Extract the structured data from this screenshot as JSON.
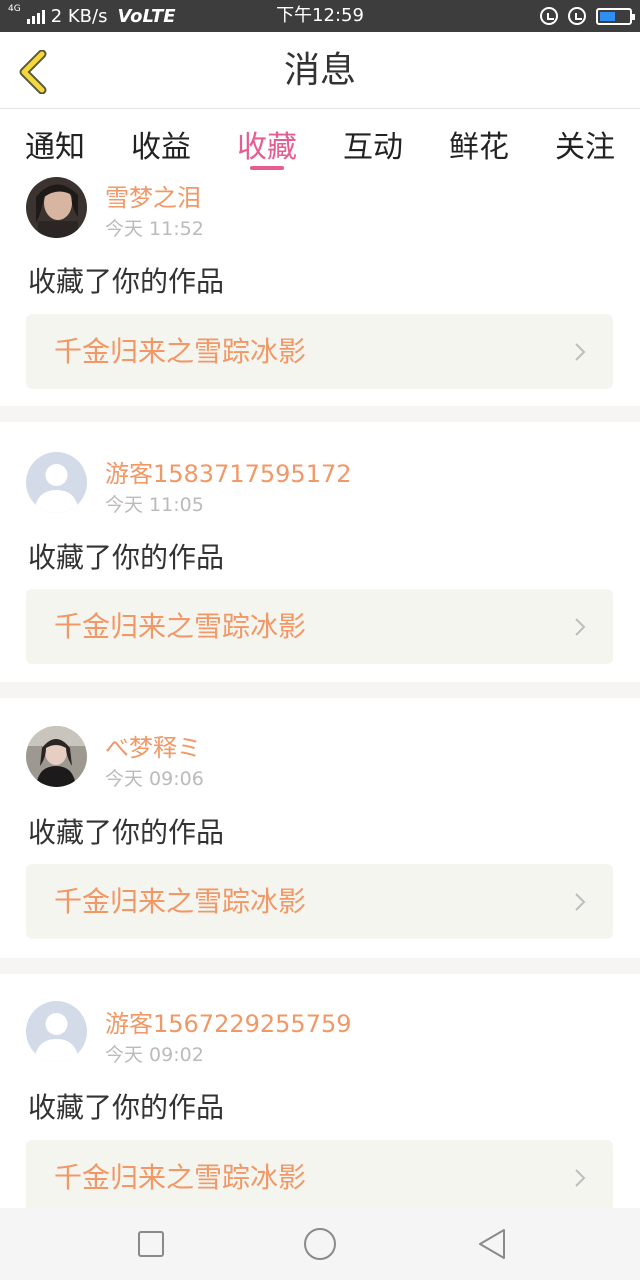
{
  "status_bar": {
    "network_type": "4G",
    "speed": "2 KB/s",
    "volte": "VoLTE",
    "time": "下午12:59",
    "battery_level": 0.55,
    "icons": [
      "signal-icon",
      "lock-rotation-icon",
      "alarm-icon",
      "battery-icon"
    ]
  },
  "header": {
    "title": "消息",
    "back_icon": "chevron-left-icon",
    "accent_color": "#f5d93a"
  },
  "tabs": [
    {
      "label": "通知",
      "active": false
    },
    {
      "label": "收益",
      "active": false
    },
    {
      "label": "收藏",
      "active": true
    },
    {
      "label": "互动",
      "active": false
    },
    {
      "label": "鲜花",
      "active": false
    },
    {
      "label": "关注",
      "active": false
    }
  ],
  "items": [
    {
      "name": "雪梦之泪",
      "time": "今天 11:52",
      "action": "收藏了你的作品",
      "work": "千金归来之雪踪冰影",
      "avatar": "photo"
    },
    {
      "name": "游客1583717595172",
      "time": "今天 11:05",
      "action": "收藏了你的作品",
      "work": "千金归来之雪踪冰影",
      "avatar": "default"
    },
    {
      "name": "べ梦释ミ",
      "time": "今天 09:06",
      "action": "收藏了你的作品",
      "work": "千金归来之雪踪冰影",
      "avatar": "photo"
    },
    {
      "name": "游客1567229255759",
      "time": "今天 09:02",
      "action": "收藏了你的作品",
      "work": "千金归来之雪踪冰影",
      "avatar": "default"
    }
  ],
  "nav_bar": {
    "icons": [
      "recent-apps-icon",
      "home-icon",
      "back-icon"
    ]
  },
  "colors": {
    "accent_pink": "#e75c93",
    "name_orange": "#f19866",
    "work_bg": "#f5f5f0"
  }
}
